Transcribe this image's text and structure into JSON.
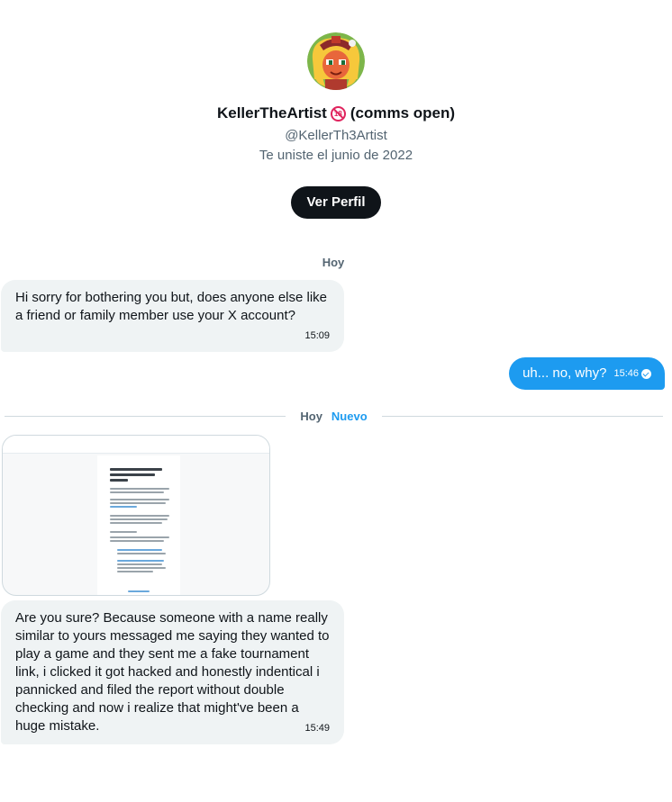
{
  "profile": {
    "display_name": "KellerTheArtist",
    "name_suffix": "(comms open)",
    "age_badge": "18",
    "handle": "@KellerTh3Artist",
    "joined": "Te uniste el junio de 2022",
    "view_profile_label": "Ver Perfil"
  },
  "conversation": {
    "day_label": "Hoy",
    "messages": [
      {
        "direction": "incoming",
        "text": "Hi sorry for bothering you but, does anyone else like a friend or family member use your X account?",
        "time": "15:09"
      },
      {
        "direction": "outgoing",
        "text": "uh... no, why?",
        "time": "15:46",
        "status": "read"
      },
      {
        "direction": "incoming",
        "text": "Are you sure? Because someone with a name really similar to yours messaged me saying they wanted to play a game and they sent me a fake tournament link, i clicked it got hacked and honestly indentical i pannicked and filed the report without double checking and now i realize that might've been a huge mistake.",
        "time": "15:49"
      }
    ],
    "divider": {
      "day": "Hoy",
      "new_label": "Nuevo"
    }
  },
  "colors": {
    "accent": "#1d9bf0",
    "incoming_bubble": "#eff3f4",
    "text_primary": "#0f1419",
    "text_secondary": "#536471",
    "badge_red": "#e0245e"
  },
  "icons": {
    "read_status": "check-circle-icon",
    "age_badge": "no-under-18-icon"
  }
}
